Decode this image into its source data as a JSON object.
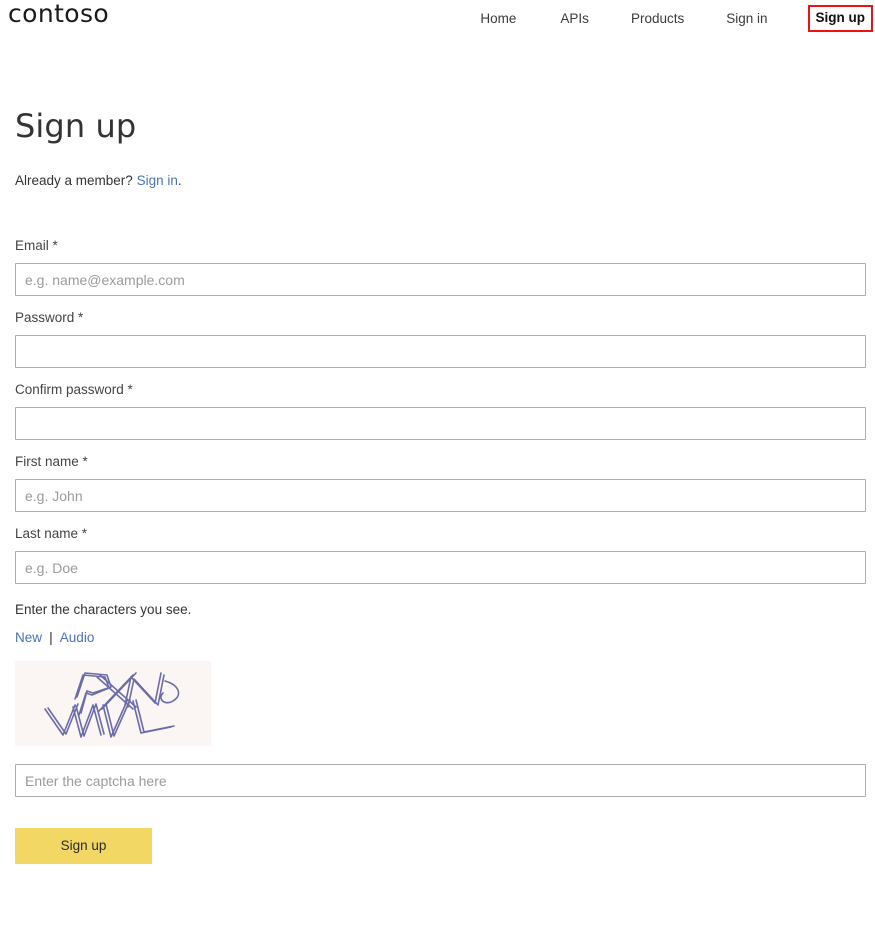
{
  "header": {
    "brand": "contoso",
    "nav": [
      {
        "label": "Home",
        "highlighted": false
      },
      {
        "label": "APIs",
        "highlighted": false
      },
      {
        "label": "Products",
        "highlighted": false
      },
      {
        "label": "Sign in",
        "highlighted": false
      },
      {
        "label": "Sign up",
        "highlighted": true
      }
    ],
    "highlight_color": "#ee1111"
  },
  "main": {
    "title": "Sign up",
    "member_prompt": "Already a member?",
    "member_link": "Sign in",
    "member_suffix": ".",
    "fields": [
      {
        "label": "Email *",
        "placeholder": "e.g. name@example.com",
        "value": "",
        "type": "email"
      },
      {
        "label": "Password *",
        "placeholder": "",
        "value": "",
        "type": "password"
      },
      {
        "label": "Confirm password *",
        "placeholder": "",
        "value": "",
        "type": "password"
      },
      {
        "label": "First name *",
        "placeholder": "e.g. John",
        "value": "",
        "type": "text"
      },
      {
        "label": "Last name *",
        "placeholder": "e.g. Doe",
        "value": "",
        "type": "text"
      }
    ],
    "captcha": {
      "instruction": "Enter the characters you see.",
      "new_label": "New",
      "separator": "|",
      "audio_label": "Audio",
      "image_alt": "captcha-image",
      "image_background": "#fbf5f3",
      "image_stroke": "#6b6ba8",
      "input_placeholder": "Enter the captcha here",
      "input_value": ""
    },
    "submit_label": "Sign up",
    "submit_color": "#f2d765"
  },
  "colors": {
    "link": "#4a73b8",
    "text": "#333333",
    "input_border": "#acacac",
    "placeholder": "#9b9b9b"
  }
}
